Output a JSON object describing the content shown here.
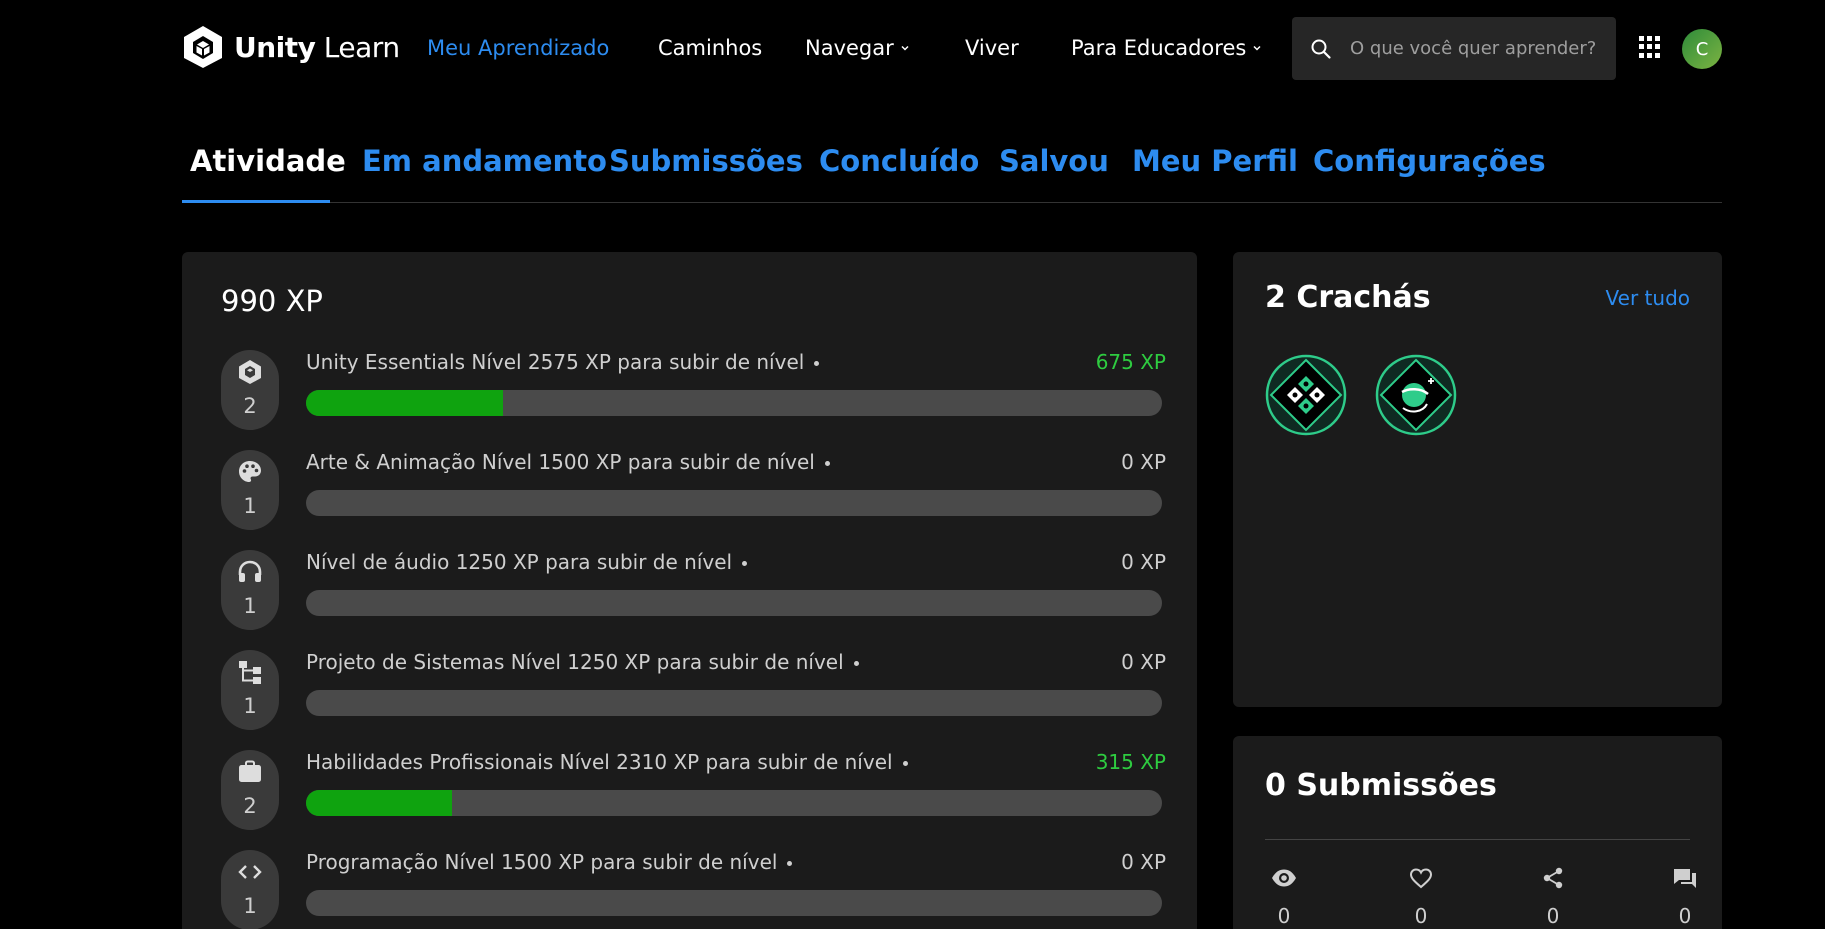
{
  "brand": {
    "name_bold": "Unity",
    "name_light": " Learn"
  },
  "nav": {
    "items": [
      {
        "label": "Meu Aprendizado",
        "active": true,
        "dropdown": false
      },
      {
        "label": "Caminhos",
        "active": false,
        "dropdown": false
      },
      {
        "label": "Navegar",
        "active": false,
        "dropdown": true
      },
      {
        "label": "Viver",
        "active": false,
        "dropdown": false
      },
      {
        "label": "Para Educadores",
        "active": false,
        "dropdown": true
      }
    ],
    "search_placeholder": "O que você quer aprender?",
    "avatar_initial": "C"
  },
  "tabs": [
    {
      "label": "Atividade",
      "active": true
    },
    {
      "label": "Em andamento",
      "active": false
    },
    {
      "label": "Submissões",
      "active": false
    },
    {
      "label": "Concluído",
      "active": false
    },
    {
      "label": "Salvou",
      "active": false
    },
    {
      "label": "Meu Perfil",
      "active": false
    },
    {
      "label": "Configurações",
      "active": false
    }
  ],
  "xp": {
    "total": "990 XP",
    "skills": [
      {
        "icon": "unity-cube-icon",
        "level": "2",
        "name": "Unity Essentials Nível 2575 XP para subir de nível",
        "xp": "675 XP",
        "progress": 0.23
      },
      {
        "icon": "palette-icon",
        "level": "1",
        "name": "Arte & Animação Nível 1500 XP para subir de nível",
        "xp": "0 XP",
        "progress": 0
      },
      {
        "icon": "headphones-icon",
        "level": "1",
        "name": "Nível de áudio 1250 XP para subir de nível",
        "xp": "0 XP",
        "progress": 0
      },
      {
        "icon": "hierarchy-icon",
        "level": "1",
        "name": "Projeto de Sistemas Nível 1250 XP para subir de nível",
        "xp": "0 XP",
        "progress": 0
      },
      {
        "icon": "briefcase-icon",
        "level": "2",
        "name": "Habilidades Profissionais Nível 2310 XP para subir de nível",
        "xp": "315 XP",
        "progress": 0.17
      },
      {
        "icon": "code-icon",
        "level": "1",
        "name": "Programação Nível 1500 XP para subir de nível",
        "xp": "0 XP",
        "progress": 0
      }
    ]
  },
  "badges": {
    "title": "2 Crachás",
    "see_all": "Ver tudo",
    "items": [
      "gamepad-badge-icon",
      "planet-badge-icon"
    ]
  },
  "submissions": {
    "title": "0 Submissões",
    "stats": [
      {
        "icon": "eye-icon",
        "value": "0"
      },
      {
        "icon": "heart-icon",
        "value": "0"
      },
      {
        "icon": "share-icon",
        "value": "0"
      },
      {
        "icon": "comment-icon",
        "value": "0"
      }
    ]
  },
  "colors": {
    "accent": "#2d8cf0",
    "progress": "#0fa30f",
    "xp_gain": "#2ecc40",
    "panel": "#1b1b1b"
  }
}
